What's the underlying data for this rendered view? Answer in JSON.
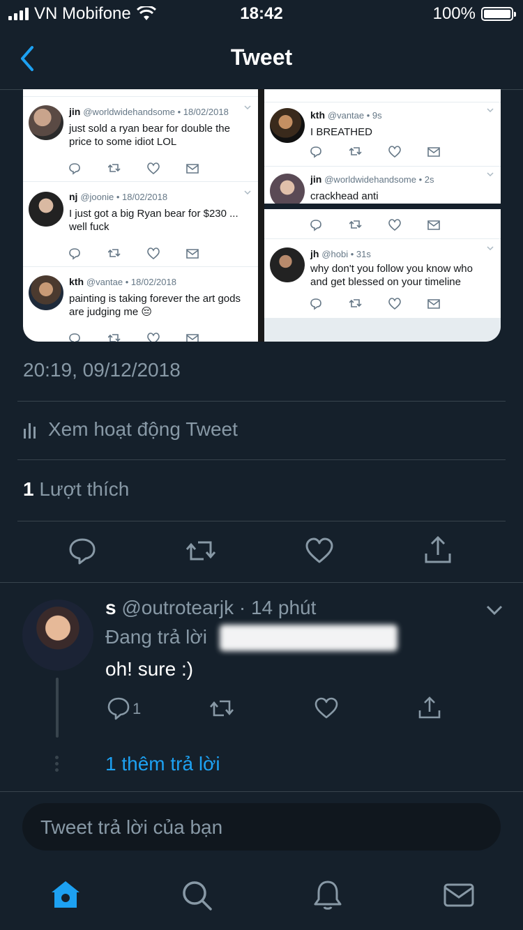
{
  "status_bar": {
    "carrier": "VN Mobifone",
    "time": "18:42",
    "battery": "100%",
    "battery_level": 1.0
  },
  "nav": {
    "title": "Tweet"
  },
  "media": {
    "left_tweets": [
      {
        "name": "jin",
        "handle": "@worldwidehandsome",
        "date": "18/02/2018",
        "text": "just sold a ryan bear for double the price to some idiot LOL"
      },
      {
        "name": "nj",
        "handle": "@joonie",
        "date": "18/02/2018",
        "text": "I just got a big Ryan bear for $230 ... well fuck"
      },
      {
        "name": "kth",
        "handle": "@vantae",
        "date": "18/02/2018",
        "text": "painting is taking forever the art gods are judging me 😔"
      }
    ],
    "right_tweets": [
      {
        "name": "kth",
        "handle": "@vantae",
        "date": "9s",
        "text": "I BREATHED"
      },
      {
        "name": "jin",
        "handle": "@worldwidehandsome",
        "date": "2s",
        "text": "crackhead anti"
      },
      {
        "name": "jh",
        "handle": "@hobi",
        "date": "31s",
        "text": "why don't you follow you know who and get blessed on your timeline"
      }
    ]
  },
  "tweet_meta": {
    "timestamp": "20:19, 09/12/2018",
    "activity_label": "Xem hoạt động Tweet",
    "likes_count": "1",
    "likes_label": "Lượt thích"
  },
  "reply": {
    "name": "s",
    "handle": "@outrotearjk",
    "time": "· 14 phút",
    "replying_label": "Đang trả lời",
    "text": "oh! sure :)",
    "reply_count": "1",
    "more_replies": "1 thêm trả lời"
  },
  "composer": {
    "placeholder": "Tweet trả lời của bạn"
  },
  "colors": {
    "background": "#15202b",
    "accent": "#1da1f2",
    "muted": "#8899a6",
    "divider": "#38444d"
  },
  "tabs": [
    "home-icon",
    "search-icon",
    "bell-icon",
    "mail-icon"
  ]
}
